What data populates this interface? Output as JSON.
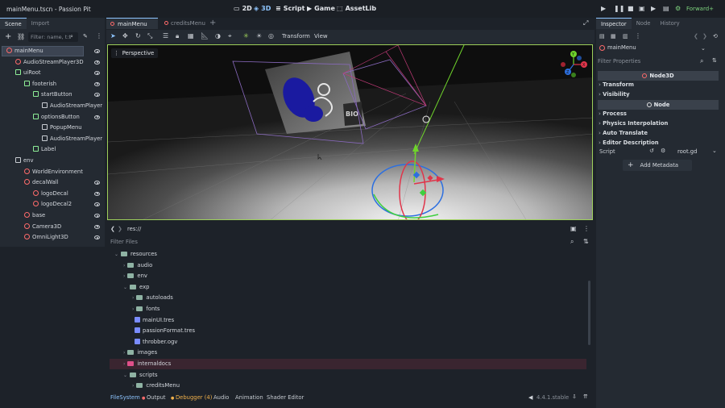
{
  "window": {
    "title": "mainMenu.tscn - Passion Pit"
  },
  "workspaces": [
    {
      "label": "2D",
      "active": false
    },
    {
      "label": "3D",
      "active": true
    },
    {
      "label": "Script",
      "active": false
    },
    {
      "label": "Game",
      "active": false
    },
    {
      "label": "AssetLib",
      "active": false
    }
  ],
  "renderer": "Forward+",
  "scene_dock": {
    "tabs": [
      "Scene",
      "Import"
    ],
    "filter_placeholder": "Filter: name, t:t",
    "tree": [
      {
        "label": "mainMenu",
        "depth": 0,
        "color": "#ff6b6b",
        "eye": true,
        "selected": true
      },
      {
        "label": "AudioStreamPlayer3D",
        "depth": 1,
        "color": "#ff6b6b",
        "eye": true
      },
      {
        "label": "uiRoot",
        "depth": 1,
        "color": "#8eef97",
        "eye": true
      },
      {
        "label": "footerish",
        "depth": 2,
        "color": "#8eef97",
        "eye": true
      },
      {
        "label": "startButton",
        "depth": 3,
        "color": "#8eef97",
        "eye": true
      },
      {
        "label": "AudioStreamPlayer",
        "depth": 4,
        "color": "#c9cdd3",
        "eye": false
      },
      {
        "label": "optionsButton",
        "depth": 3,
        "color": "#8eef97",
        "eye": true
      },
      {
        "label": "PopupMenu",
        "depth": 4,
        "color": "#c9cdd3",
        "eye": false
      },
      {
        "label": "AudioStreamPlayer",
        "depth": 4,
        "color": "#c9cdd3",
        "eye": false
      },
      {
        "label": "Label",
        "depth": 3,
        "color": "#8eef97",
        "eye": false
      },
      {
        "label": "env",
        "depth": 1,
        "color": "#c9cdd3",
        "eye": false
      },
      {
        "label": "WorldEnvironment",
        "depth": 2,
        "color": "#ff6b6b",
        "eye": false
      },
      {
        "label": "decalWall",
        "depth": 2,
        "color": "#ff6b6b",
        "eye": true
      },
      {
        "label": "logoDecal",
        "depth": 3,
        "color": "#ff6b6b",
        "eye": true
      },
      {
        "label": "logoDecal2",
        "depth": 3,
        "color": "#ff6b6b",
        "eye": true
      },
      {
        "label": "base",
        "depth": 2,
        "color": "#ff6b6b",
        "eye": true
      },
      {
        "label": "Camera3D",
        "depth": 2,
        "color": "#ff6b6b",
        "eye": true
      },
      {
        "label": "OmniLight3D",
        "depth": 2,
        "color": "#ff6b6b",
        "eye": true
      }
    ]
  },
  "editor_tabs": [
    "mainMenu",
    "creditsMenu"
  ],
  "viewport": {
    "menus": [
      "Transform",
      "View"
    ],
    "perspective_label": "Perspective",
    "gizmo_axes": [
      "Y",
      "X",
      "Z"
    ]
  },
  "filesystem": {
    "path": "res://",
    "filter_placeholder": "Filter Files",
    "items": [
      {
        "label": "resources",
        "depth": 0,
        "type": "folder",
        "expanded": true
      },
      {
        "label": "audio",
        "depth": 1,
        "type": "folder"
      },
      {
        "label": "env",
        "depth": 1,
        "type": "folder"
      },
      {
        "label": "exp",
        "depth": 1,
        "type": "folder",
        "expanded": true
      },
      {
        "label": "autoloads",
        "depth": 2,
        "type": "folder"
      },
      {
        "label": "fonts",
        "depth": 2,
        "type": "folder"
      },
      {
        "label": "mainUI.tres",
        "depth": 2,
        "type": "file"
      },
      {
        "label": "passionFormat.tres",
        "depth": 2,
        "type": "file"
      },
      {
        "label": "throbber.ogv",
        "depth": 2,
        "type": "file"
      },
      {
        "label": "images",
        "depth": 1,
        "type": "folder"
      },
      {
        "label": "internaldocs",
        "depth": 1,
        "type": "folder",
        "highlight": true
      },
      {
        "label": "scripts",
        "depth": 1,
        "type": "folder",
        "expanded": true
      },
      {
        "label": "creditsMenu",
        "depth": 2,
        "type": "folder"
      }
    ]
  },
  "bottom_tabs": [
    "FileSystem",
    "Output",
    "Debugger (4)",
    "Audio",
    "Animation",
    "Shader Editor"
  ],
  "version": "4.4.1.stable",
  "inspector": {
    "tabs": [
      "Inspector",
      "Node",
      "History"
    ],
    "object": "mainMenu",
    "filter_placeholder": "Filter Properties",
    "sections": [
      {
        "kind": "header",
        "label": "Node3D"
      },
      {
        "kind": "group",
        "label": "Transform"
      },
      {
        "kind": "group",
        "label": "Visibility"
      },
      {
        "kind": "header",
        "label": "Node"
      },
      {
        "kind": "group",
        "label": "Process"
      },
      {
        "kind": "group",
        "label": "Physics Interpolation"
      },
      {
        "kind": "group",
        "label": "Auto Translate"
      },
      {
        "kind": "group",
        "label": "Editor Description"
      }
    ],
    "script_label": "Script",
    "script_value": "root.gd",
    "add_metadata": "Add Metadata"
  }
}
